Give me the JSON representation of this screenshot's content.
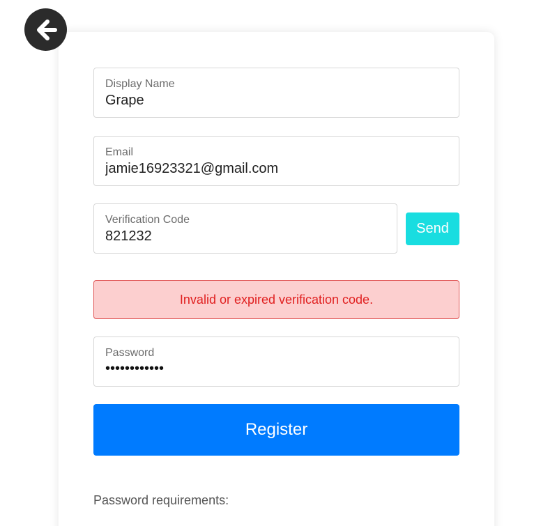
{
  "back_button": {
    "icon": "arrow-left-icon"
  },
  "form": {
    "display_name": {
      "label": "Display Name",
      "value": "Grape"
    },
    "email": {
      "label": "Email",
      "value": "jamie16923321@gmail.com"
    },
    "verification_code": {
      "label": "Verification Code",
      "value": "821232"
    },
    "send_label": "Send",
    "error_message": "Invalid or expired verification code.",
    "password": {
      "label": "Password",
      "masked_value": "••••••••••••"
    },
    "register_label": "Register",
    "requirements_heading": "Password requirements:"
  },
  "colors": {
    "send_button": "#19dde0",
    "register_button": "#007bff",
    "error_background": "#fccfcf",
    "error_text": "#e01f1f",
    "back_button": "#2b2b2b"
  }
}
